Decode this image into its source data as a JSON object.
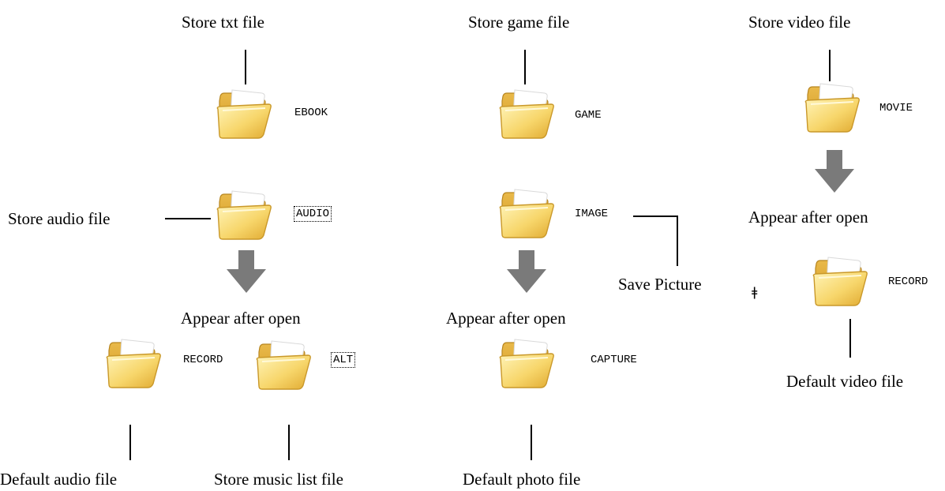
{
  "captions": {
    "store_txt": "Store txt file",
    "store_game": "Store game file",
    "store_video": "Store video file",
    "store_audio": "Store audio file",
    "appear_after_open_1": "Appear after open",
    "appear_after_open_2": "Appear after open",
    "appear_after_open_3": "Appear after open",
    "save_picture": "Save Picture",
    "default_audio": "Default audio file",
    "store_music_list": "Store music list file",
    "default_photo": "Default photo file",
    "default_video": "Default video file"
  },
  "folders": {
    "ebook": "EBOOK",
    "game": "GAME",
    "movie": "MOVIE",
    "audio": "AUDIO",
    "image": "IMAGE",
    "record_audio": "RECORD",
    "alt": "ALT",
    "capture": "CAPTURE",
    "record_video": "RECORD"
  },
  "stray_mark": "ǂ",
  "colors": {
    "folder_fill": "#F7D66B",
    "folder_edge": "#C9982A",
    "arrow": "#7A7A7A"
  },
  "icons": {
    "folder": "folder-icon",
    "arrow": "arrow-down-icon"
  }
}
